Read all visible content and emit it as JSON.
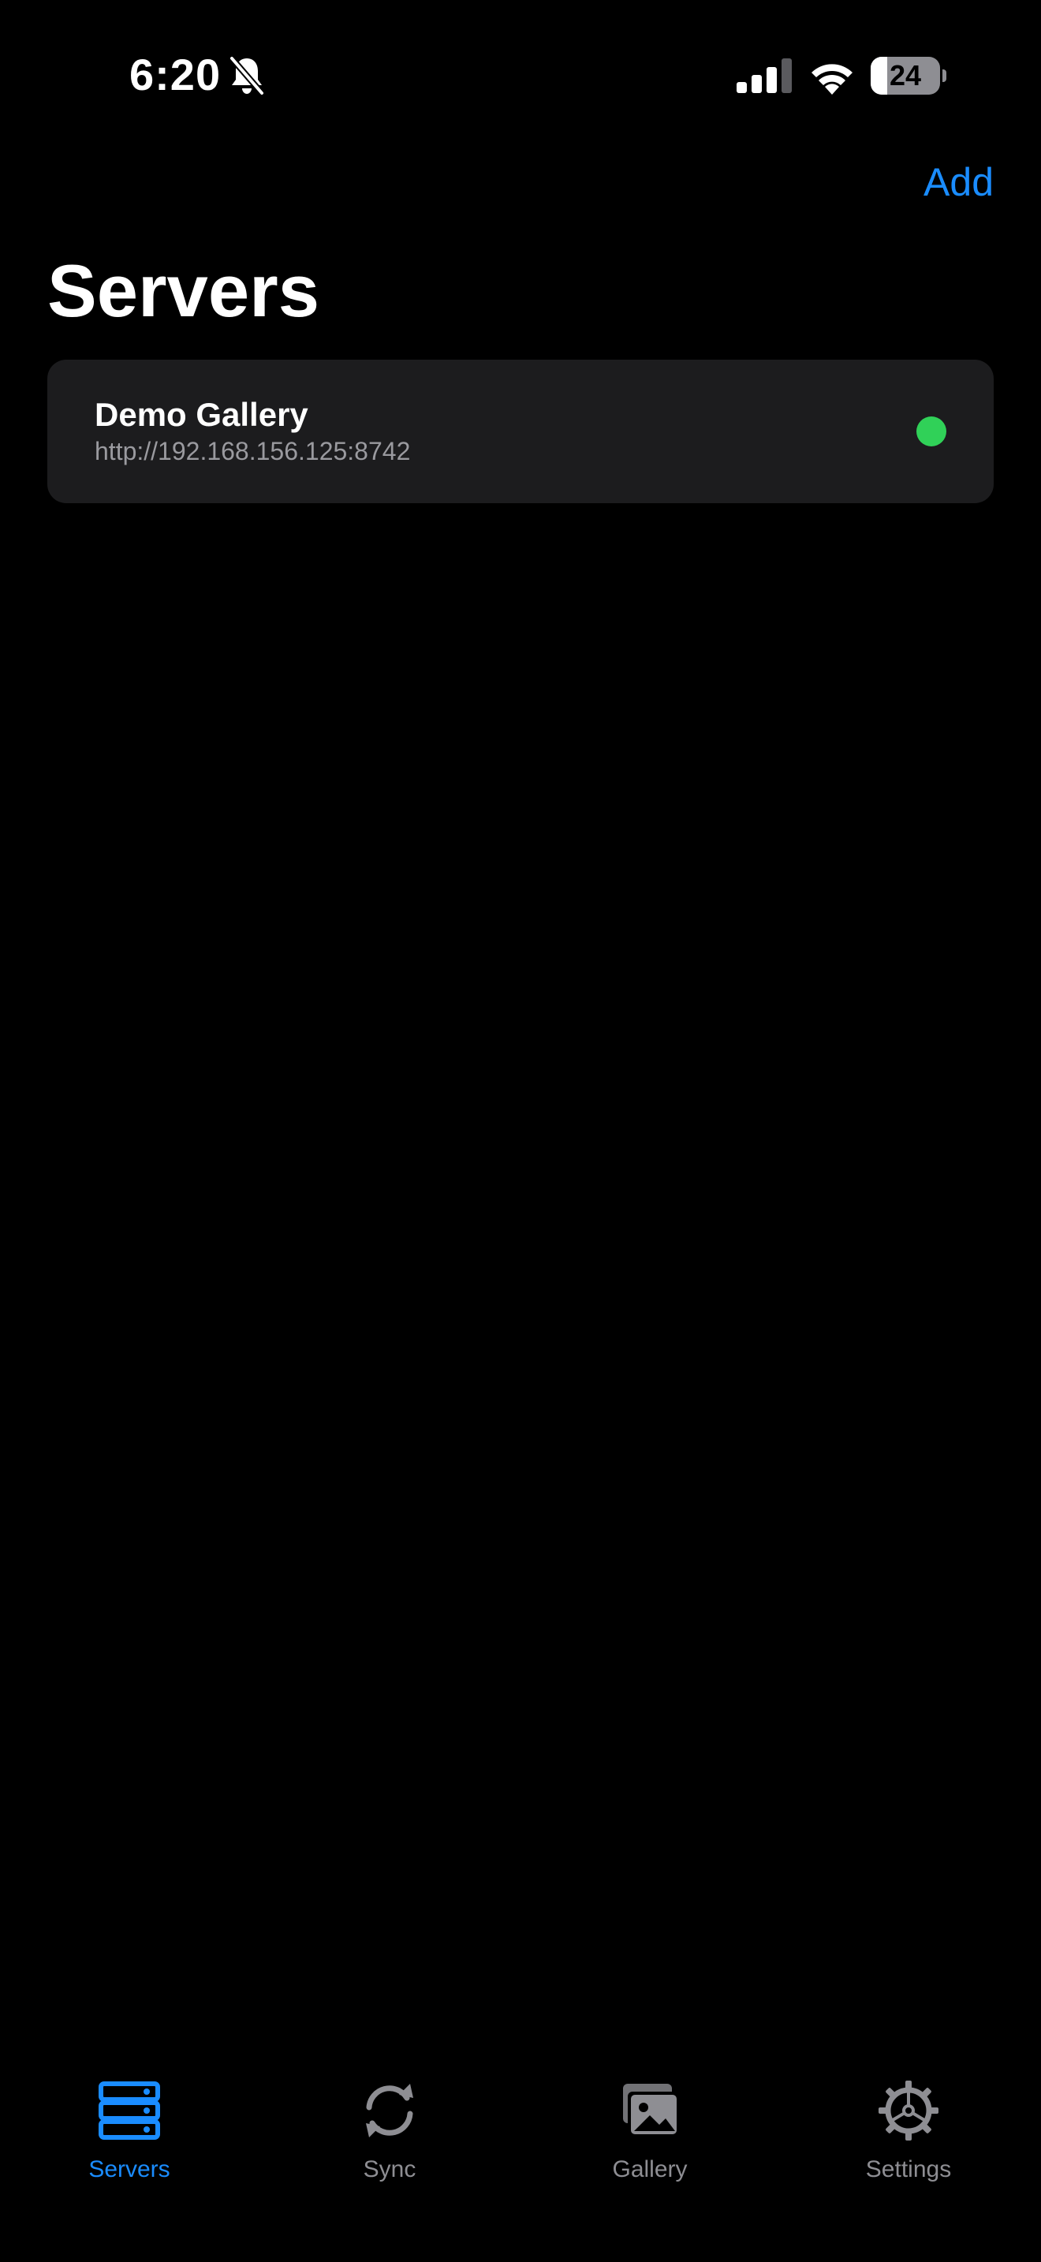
{
  "status_bar": {
    "time": "6:20",
    "battery_level": "24",
    "battery_fraction": 0.24,
    "icons": [
      "bell-slash-icon",
      "cellular-signal-icon",
      "wifi-icon",
      "battery-icon"
    ]
  },
  "header": {
    "add_label": "Add",
    "title": "Servers"
  },
  "servers": [
    {
      "name": "Demo Gallery",
      "url": "http://192.168.156.125:8742",
      "status_color": "#30d158"
    }
  ],
  "tab_bar": {
    "tabs": [
      {
        "label": "Servers",
        "icon": "server-rack-icon",
        "active": true
      },
      {
        "label": "Sync",
        "icon": "sync-arrows-icon",
        "active": false
      },
      {
        "label": "Gallery",
        "icon": "photo-stack-icon",
        "active": false
      },
      {
        "label": "Settings",
        "icon": "gear-icon",
        "active": false
      }
    ]
  },
  "colors": {
    "accent": "#1a8cff",
    "background": "#000000",
    "card": "#1c1c1e",
    "inactive": "#8e8e93",
    "online": "#30d158"
  }
}
